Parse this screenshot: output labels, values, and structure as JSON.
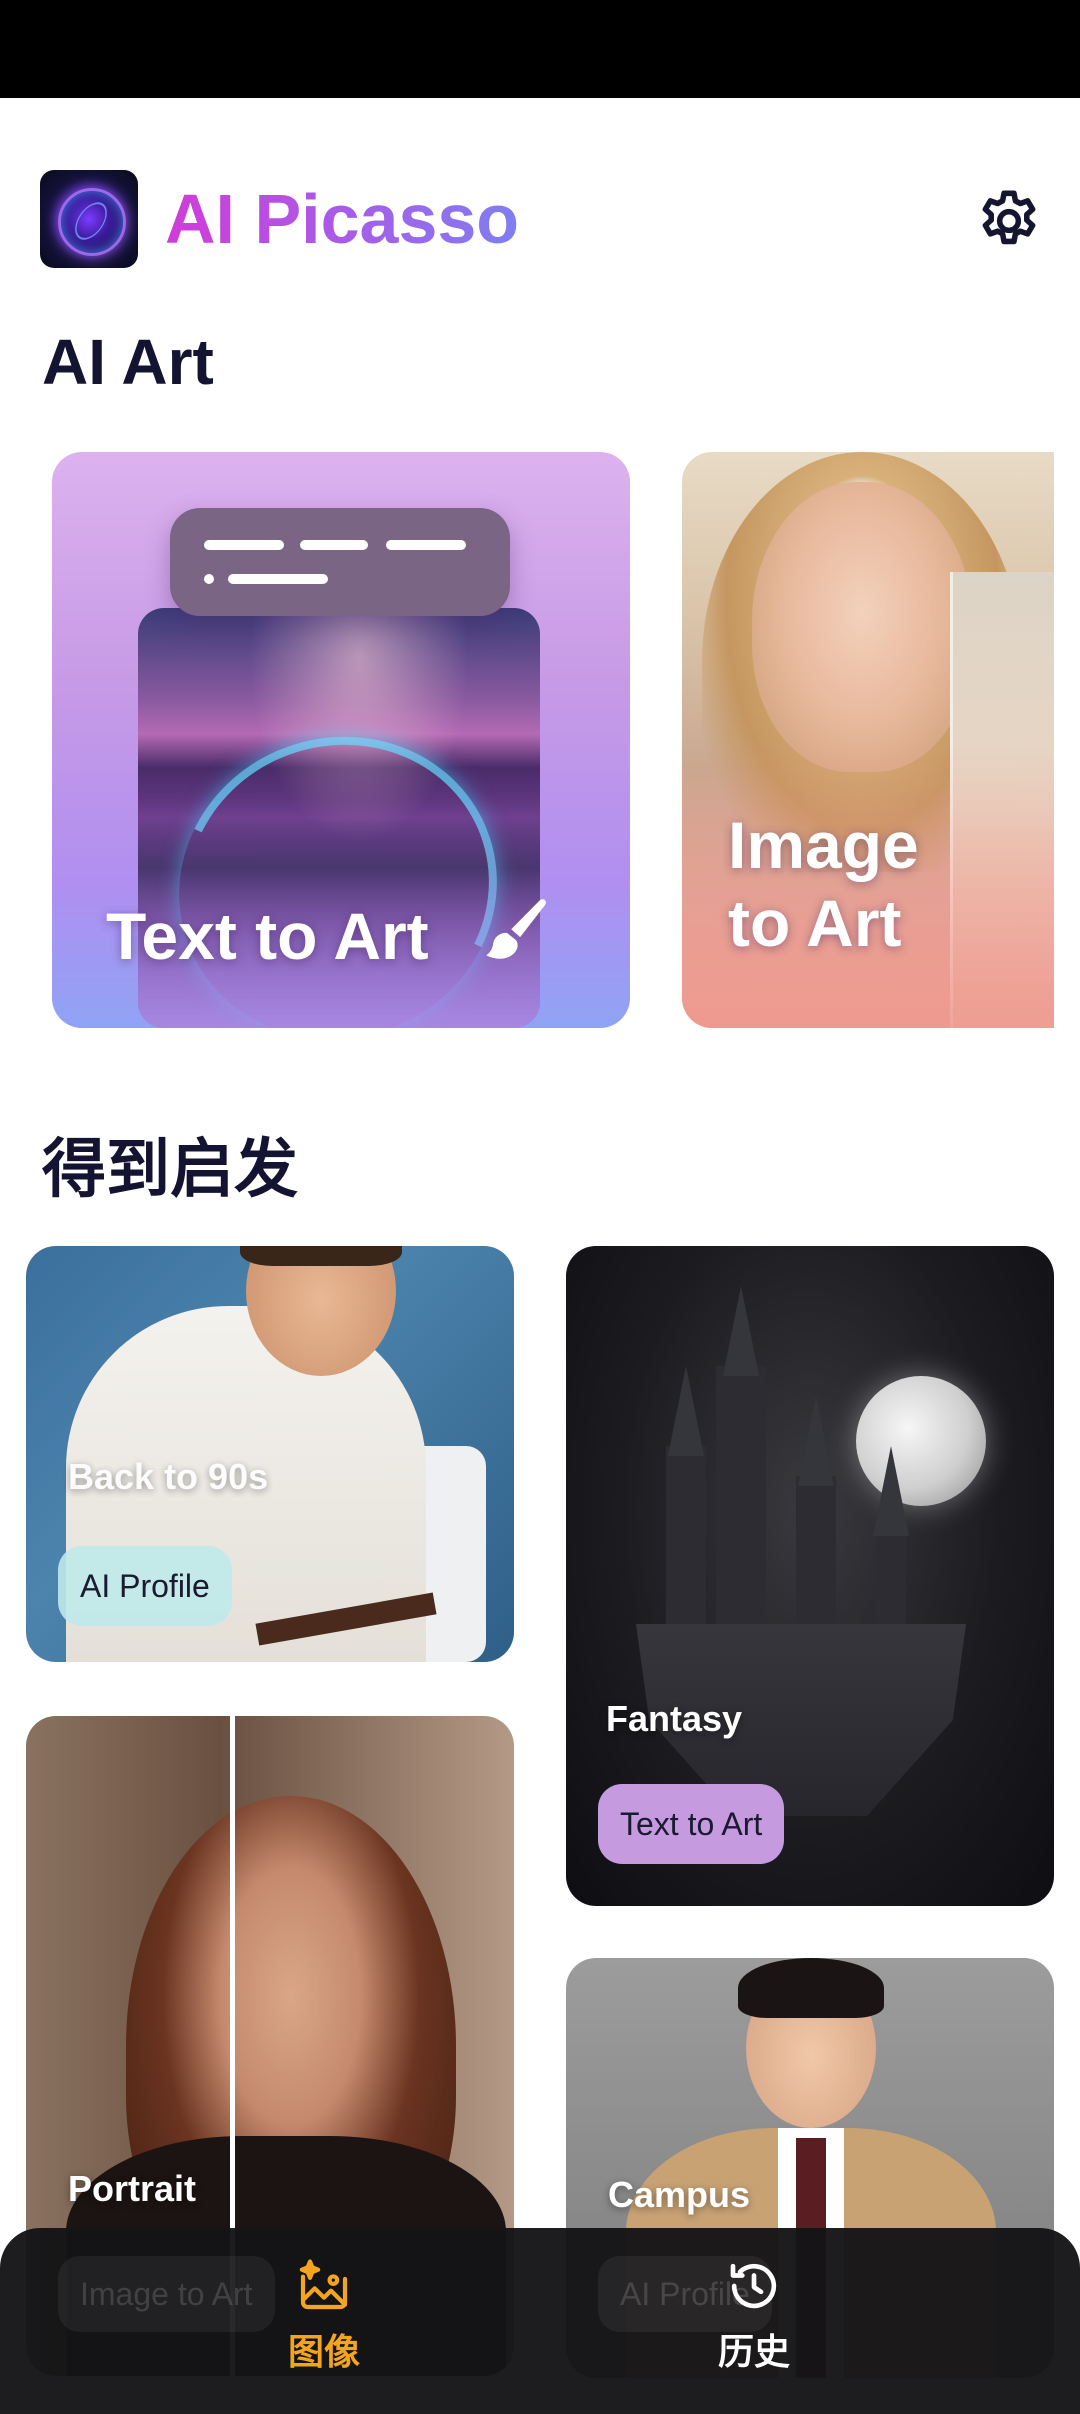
{
  "app": {
    "title": "AI Picasso"
  },
  "sections": {
    "ai_art": "AI Art",
    "inspiration": "得到启发"
  },
  "ai_art_cards": [
    {
      "label": "Text to Art"
    },
    {
      "label_line1": "Image",
      "label_line2": "to Art"
    }
  ],
  "inspiration_cards": [
    {
      "title": "Back to 90s",
      "tag": "AI Profile"
    },
    {
      "title": "Fantasy",
      "tag": "Text to Art"
    },
    {
      "title": "Portrait",
      "tag": "Image to Art"
    },
    {
      "title": "Campus",
      "tag": "AI Profile"
    }
  ],
  "bottom_nav": [
    {
      "label": "图像",
      "icon": "image-sparkle-icon",
      "active": true
    },
    {
      "label": "历史",
      "icon": "history-clock-icon",
      "active": false
    }
  ],
  "colors": {
    "title_gradient_start": "#d03cd8",
    "title_gradient_end": "#7f7ff0",
    "nav_active": "#f4a51c",
    "tag_ai_profile": "#bfe9ea",
    "tag_text_to_art": "#c59adf"
  }
}
